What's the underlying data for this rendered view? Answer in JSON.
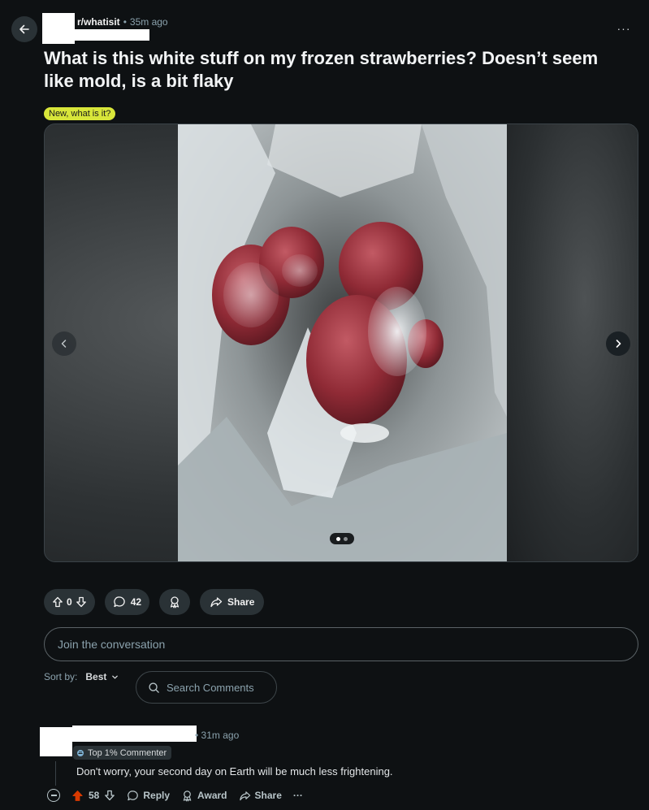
{
  "post": {
    "subreddit": "r/whatisit",
    "separator": "•",
    "time": "35m ago",
    "title": "What is this white stuff on my frozen strawberries? Doesn’t seem like mold, is a bit flaky",
    "flair": "New, what is it?",
    "more": "···",
    "gallery": {
      "current": 1,
      "total": 2
    }
  },
  "actions": {
    "score": "0",
    "comments": "42",
    "share": "Share"
  },
  "join": {
    "placeholder": "Join the conversation"
  },
  "sort": {
    "label": "Sort by:",
    "value": "Best"
  },
  "search": {
    "placeholder": "Search Comments"
  },
  "comment": {
    "time": "31m ago",
    "badge": "Top 1% Commenter",
    "body": "Don't worry, your second day on Earth will be much less frightening.",
    "score": "58",
    "reply": "Reply",
    "award": "Award",
    "share": "Share",
    "more": "···"
  },
  "colors": {
    "background": "#0e1113",
    "pill": "#2a3236",
    "flair": "#d8e63a",
    "upvote_active": "#d93a00",
    "muted_text": "#8ba2ad"
  },
  "icons": {
    "back": "arrow-left-icon",
    "upvote": "arrow-up-icon",
    "downvote": "arrow-down-icon",
    "comment": "speech-bubble-icon",
    "award": "award-ribbon-icon",
    "share": "share-arrow-icon",
    "search": "magnifier-icon",
    "chevron": "chevron-down-icon",
    "collapse": "minus-circle-icon"
  }
}
